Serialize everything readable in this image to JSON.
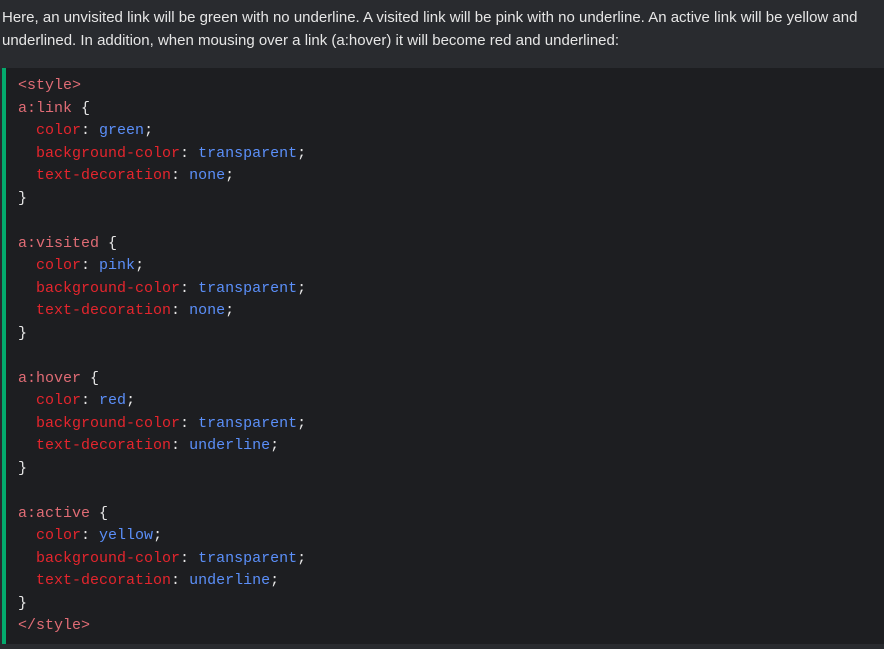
{
  "intro_text": "Here, an unvisited link will be green with no underline. A visited link will be pink with no underline. An active link will be yellow and underlined. In addition, when mousing over a link (a:hover) it will become red and underlined:",
  "code": {
    "open_tag": "<style>",
    "close_tag": "</style>",
    "rules": [
      {
        "selector": "a:link",
        "declarations": [
          {
            "property": "color",
            "value": "green"
          },
          {
            "property": "background-color",
            "value": "transparent"
          },
          {
            "property": "text-decoration",
            "value": "none"
          }
        ]
      },
      {
        "selector": "a:visited",
        "declarations": [
          {
            "property": "color",
            "value": "pink"
          },
          {
            "property": "background-color",
            "value": "transparent"
          },
          {
            "property": "text-decoration",
            "value": "none"
          }
        ]
      },
      {
        "selector": "a:hover",
        "declarations": [
          {
            "property": "color",
            "value": "red"
          },
          {
            "property": "background-color",
            "value": "transparent"
          },
          {
            "property": "text-decoration",
            "value": "underline"
          }
        ]
      },
      {
        "selector": "a:active",
        "declarations": [
          {
            "property": "color",
            "value": "yellow"
          },
          {
            "property": "background-color",
            "value": "transparent"
          },
          {
            "property": "text-decoration",
            "value": "underline"
          }
        ]
      }
    ]
  },
  "colors": {
    "accent_border": "#04aa6d",
    "code_background": "#1d1e21",
    "page_background": "#292b2f"
  }
}
